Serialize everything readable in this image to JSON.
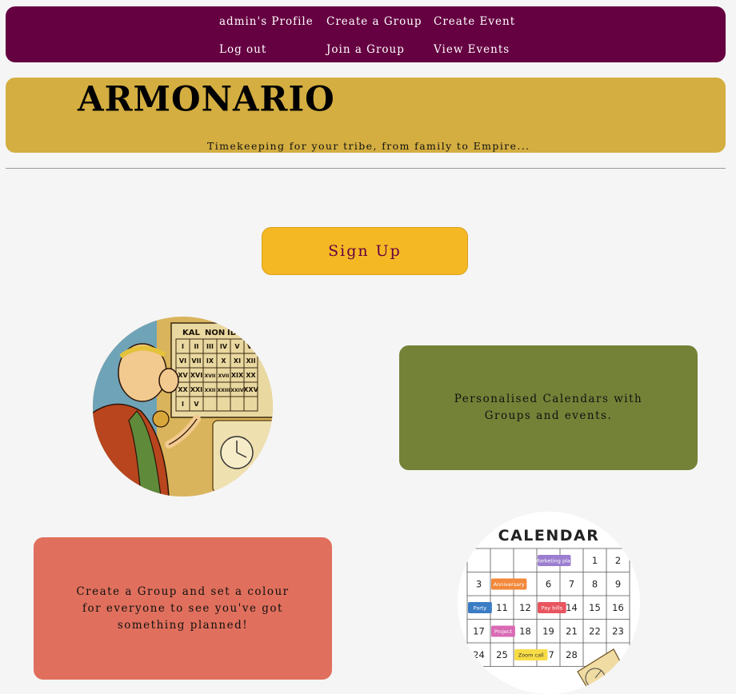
{
  "nav": {
    "profile": "admin's Profile",
    "create_group": "Create a Group",
    "create_event": "Create Event",
    "logout": "Log out",
    "join_group": "Join a Group",
    "view_events": "View Events"
  },
  "banner": {
    "brand": "ARMONARIO",
    "tagline": "Timekeeping for your tribe, from family to Empire..."
  },
  "signup_label": "Sign Up",
  "features": {
    "calendars": "Personalised Calendars with Groups and events.",
    "groups": "Create a Group and set a colour for everyone to see you've got something planned!"
  },
  "roman_calendar": {
    "header": [
      "KAL",
      "NON",
      "ID"
    ],
    "rows": [
      [
        "I",
        "II",
        "III",
        "IV",
        "V",
        "VI"
      ],
      [
        "VI",
        "VII",
        "IX",
        "X",
        "XI",
        "XII"
      ],
      [
        "XV",
        "XVI",
        "XVII",
        "XVII",
        "XIX",
        "XX"
      ],
      [
        "XX",
        "XXI",
        "XXII",
        "XXIII",
        "XXIV",
        "XXV"
      ],
      [
        "I",
        "V",
        "",
        "",
        "",
        ""
      ]
    ]
  },
  "calendar_image": {
    "title": "CALENDAR",
    "rows": [
      [
        "",
        "",
        "",
        "",
        "",
        "1",
        "2"
      ],
      [
        "3",
        "",
        "",
        "6",
        "7",
        "8",
        "9"
      ],
      [
        "",
        "11",
        "12",
        "",
        "14",
        "15",
        "16"
      ],
      [
        "17",
        "",
        "18",
        "19",
        "21",
        "22",
        "23"
      ],
      [
        "24",
        "25",
        "",
        "27",
        "28",
        "",
        ""
      ]
    ],
    "events": {
      "marketing": "Marketing plan",
      "anniversary": "Anniversary",
      "party": "Party",
      "pay_bills": "Pay bills",
      "project": "Project",
      "zoom": "Zoom call"
    },
    "colors": {
      "marketing": "#9b7ed0",
      "anniversary": "#f2883a",
      "party": "#3b7dc4",
      "pay_bills": "#e8555f",
      "project": "#d96ab4",
      "zoom": "#f7dc45"
    }
  },
  "colors": {
    "nav_bg": "#650041",
    "banner_bg": "#d4ae41",
    "signup_bg": "#f5b825",
    "signup_text": "#650041",
    "card_green": "#738237",
    "card_red": "#e0705d",
    "page_bg": "#f5f5f5"
  }
}
